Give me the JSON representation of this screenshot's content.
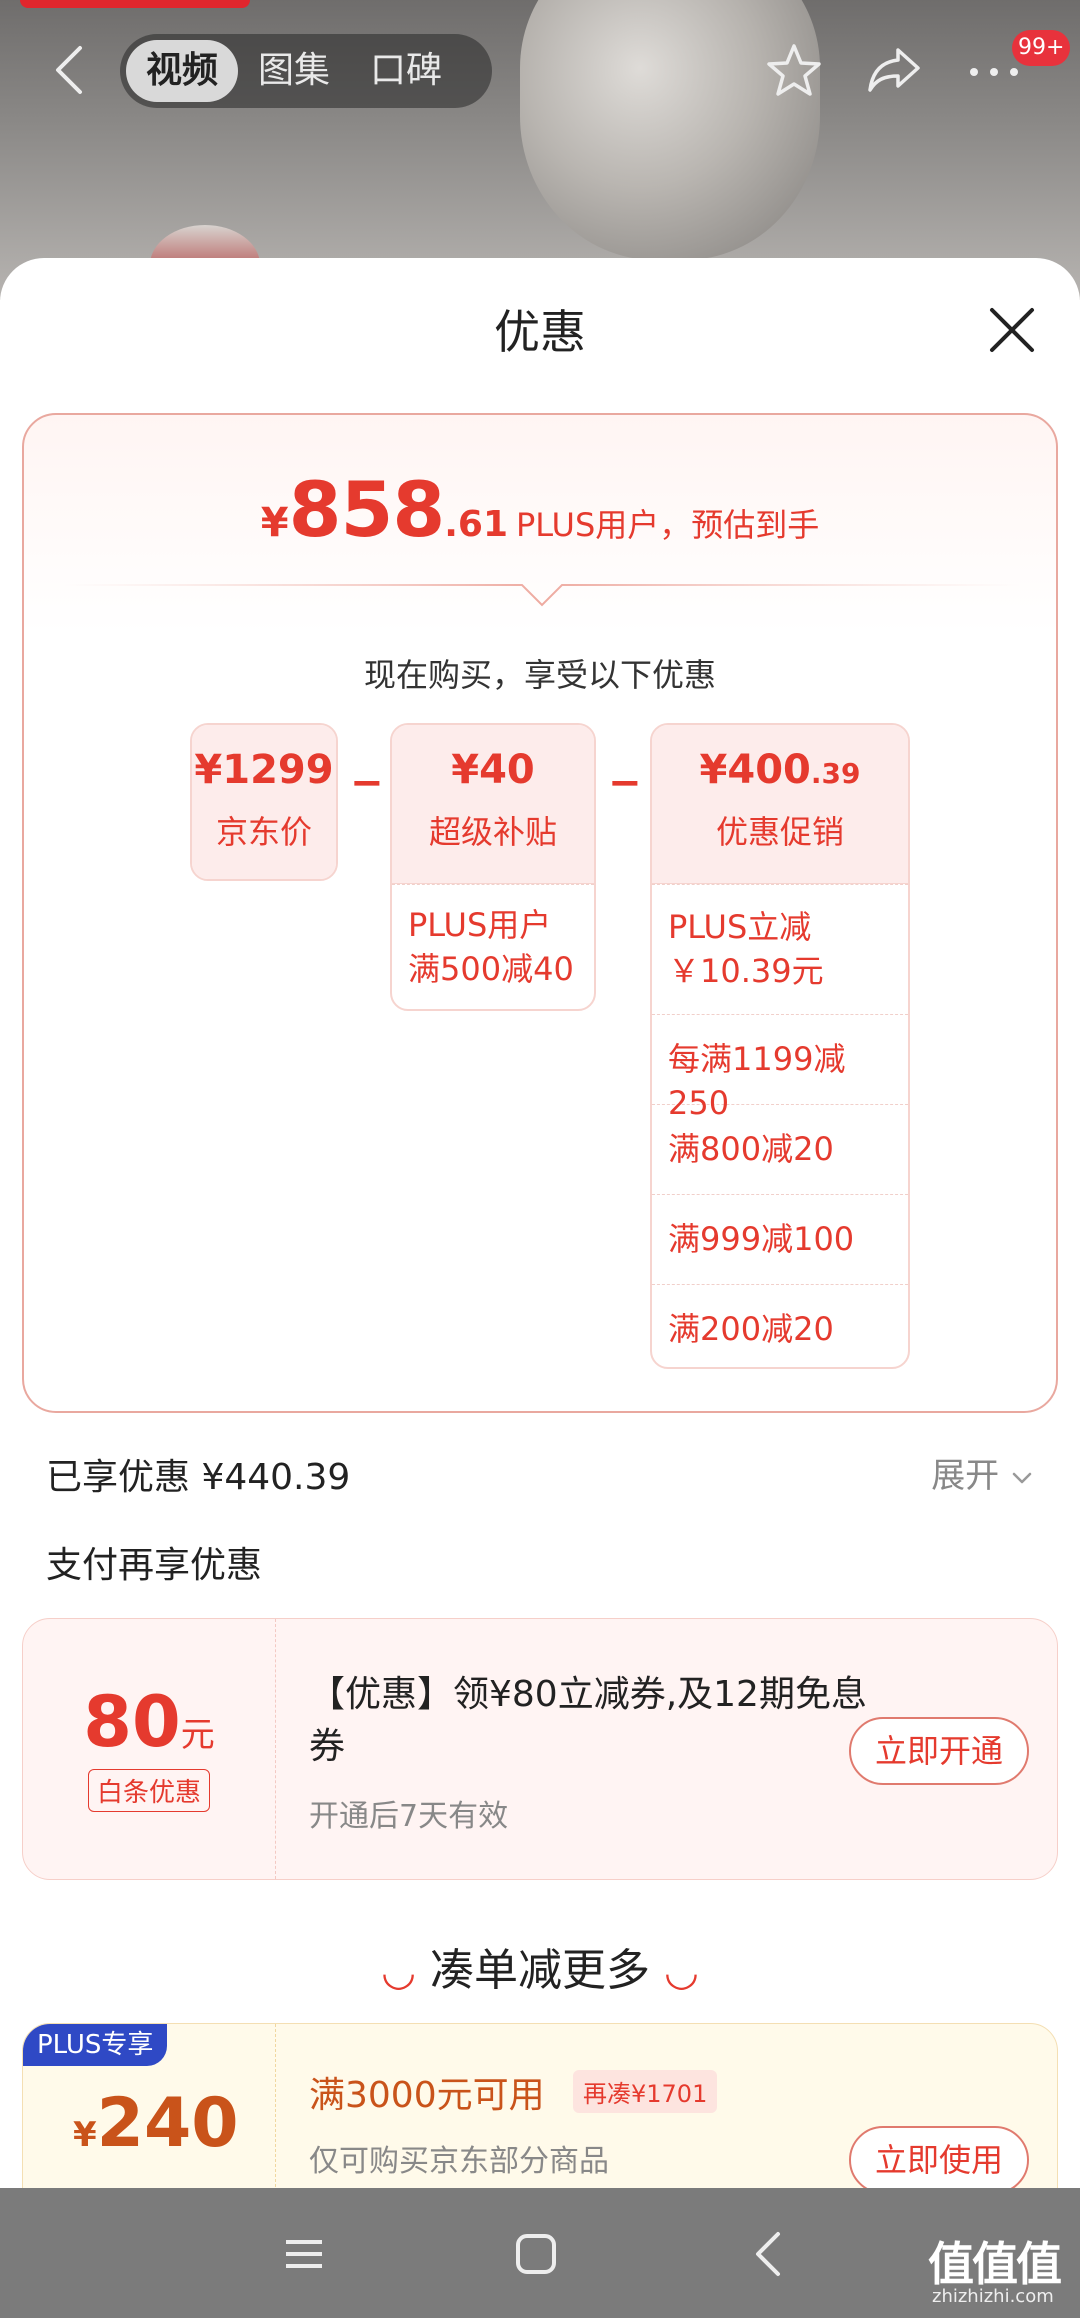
{
  "header": {
    "tabs": [
      {
        "label": "视频",
        "active": true
      },
      {
        "label": "图集",
        "active": false
      },
      {
        "label": "口碑",
        "active": false
      }
    ],
    "badge": "99+"
  },
  "sheet": {
    "title": "优惠",
    "price": {
      "yen": "¥",
      "integer": "858",
      "decimal": ".61",
      "label": "PLUS用户，预估到手"
    },
    "intro": "现在购买，享受以下优惠",
    "breakdown": {
      "base": {
        "value": "¥1299",
        "label": "京东价"
      },
      "subsidy": {
        "value": "¥40",
        "label": "超级补贴",
        "rows": [
          "PLUS用户",
          "满500减40"
        ]
      },
      "promo": {
        "value_int": "¥400",
        "value_dec": ".39",
        "label": "优惠促销",
        "rows": [
          "PLUS立减",
          "￥10.39元",
          "每满1199减250",
          "满800减20",
          "满999减100",
          "满200减20"
        ]
      },
      "minus": "−"
    },
    "enjoyed": "已享优惠 ¥440.39",
    "expand": "展开",
    "pay_more_title": "支付再享优惠",
    "baitiao": {
      "amount": "80",
      "unit": "元",
      "tag": "白条优惠",
      "text": "【优惠】领¥80立减券,及12期免息券",
      "sub": "开通后7天有效",
      "button": "立即开通"
    },
    "more_title": "凑单减更多",
    "coupon": {
      "badge": "PLUS专享",
      "yen": "¥",
      "amount": "240",
      "title": "满3000元可用",
      "tag": "再凑¥1701",
      "sub": "仅可购买京东部分商品",
      "button": "立即使用"
    }
  },
  "watermark": {
    "text": "值值值",
    "domain": "zhizhizhi.com"
  },
  "colors": {
    "accent": "#e53a2e",
    "coupon_accent": "#c9531a",
    "plus_blue": "#2f49c5"
  }
}
